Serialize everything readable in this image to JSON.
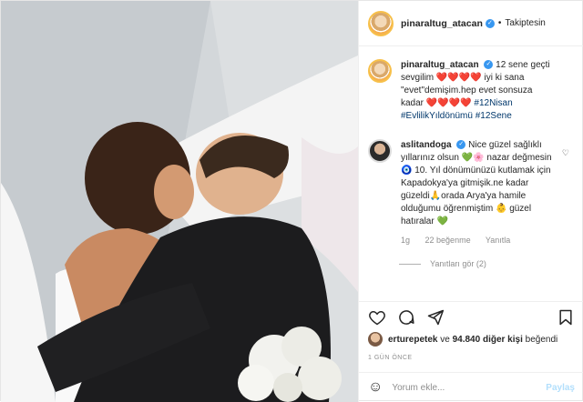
{
  "post": {
    "author": "pinaraltug_atacan",
    "follow_status": "Takiptesin",
    "separator": "•"
  },
  "caption": {
    "author": "pinaraltug_atacan",
    "text_part1": "12 sene geçti sevgilim",
    "hearts1": "❤️❤️❤️❤️",
    "text_part2": "iyi ki sana \"evet\"demişim.hep evet sonsuza kadar",
    "hearts2": "❤️❤️❤️❤️",
    "tag1": "#12Nisan",
    "tag2": "#EvlilikYıldönümü",
    "tag3": "#12Sene"
  },
  "comment": {
    "author": "aslitandoga",
    "text_line1": "Nice güzel sağlıklı yıllarınız olsun",
    "emoji1": "💚🌸",
    "text_line2": "nazar değmesin",
    "emoji2": "🧿",
    "text_line3": "10. Yıl dönümünüzü kutlamak için Kapadokya'ya gitmişik.ne kadar güzeldi",
    "emoji3": "🙏",
    "text_line4": "orada Arya'ya hamile olduğumu öğrenmiştim",
    "emoji4": "👶",
    "text_line5": "güzel hatıralar",
    "emoji5": "💚",
    "time": "1g",
    "likes": "22 beğenme",
    "reply": "Yanıtla",
    "view_replies": "Yanıtları gör (2)"
  },
  "actions": {
    "like_icon": "heart-icon",
    "comment_icon": "comment-icon",
    "share_icon": "share-icon",
    "save_icon": "bookmark-icon"
  },
  "likes": {
    "user": "erturepetek",
    "connector": "ve",
    "count": "94.840 diğer kişi",
    "suffix": "beğendi"
  },
  "timestamp": "1 GÜN ÖNCE",
  "add_comment": {
    "placeholder": "Yorum ekle...",
    "post_label": "Paylaş"
  }
}
